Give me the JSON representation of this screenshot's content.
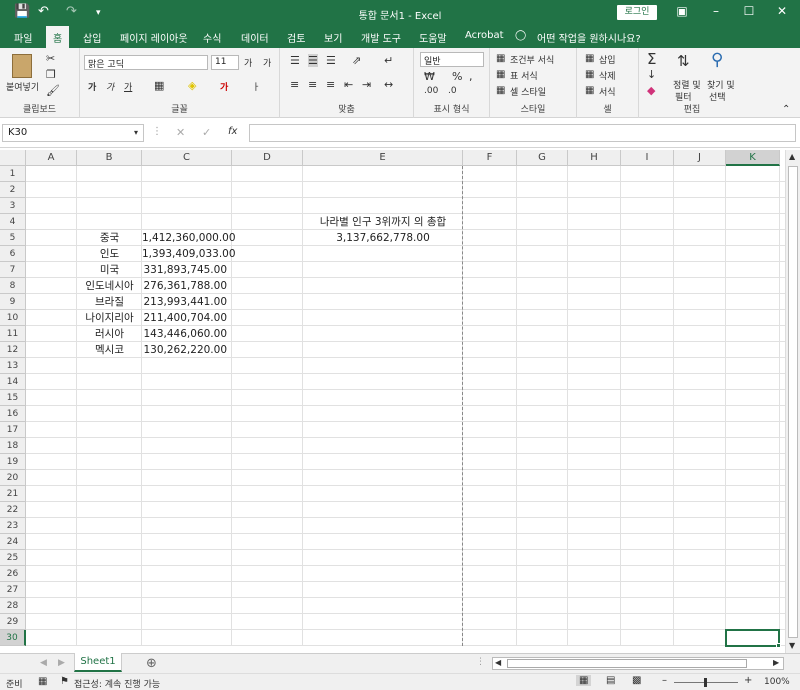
{
  "window": {
    "title": "통합 문서1  -  Excel",
    "login_label": "로그인"
  },
  "tabs": [
    {
      "label": "파일"
    },
    {
      "label": "홈"
    },
    {
      "label": "삽입"
    },
    {
      "label": "페이지 레이아웃"
    },
    {
      "label": "수식"
    },
    {
      "label": "데이터"
    },
    {
      "label": "검토"
    },
    {
      "label": "보기"
    },
    {
      "label": "개발 도구"
    },
    {
      "label": "도움말"
    },
    {
      "label": "Acrobat"
    }
  ],
  "tell_me": "어떤 작업을 원하시나요?",
  "ribbon": {
    "clipboard": {
      "paste": "붙여넣기",
      "label": "클립보드"
    },
    "font": {
      "name": "맑은 고딕",
      "size": "11",
      "label": "글꼴"
    },
    "alignment": {
      "label": "맞춤"
    },
    "number": {
      "format": "일반",
      "label": "표시 형식"
    },
    "styles": {
      "conditional": "조건부 서식",
      "table": "표 서식",
      "cell": "셀 스타일",
      "label": "스타일"
    },
    "cells": {
      "insert": "삽입",
      "delete": "삭제",
      "format": "서식",
      "label": "셀"
    },
    "editing": {
      "sort": "정렬 및",
      "filter": "필터",
      "find": "찾기 및",
      "select": "선택",
      "label": "편집"
    }
  },
  "formula_bar": {
    "name_box": "K30",
    "fx": "fx",
    "value": ""
  },
  "columns": [
    "A",
    "B",
    "C",
    "D",
    "E",
    "F",
    "G",
    "H",
    "I",
    "J",
    "K"
  ],
  "rows": [
    "1",
    "2",
    "3",
    "4",
    "5",
    "6",
    "7",
    "8",
    "9",
    "10",
    "11",
    "12",
    "13",
    "14",
    "15",
    "16",
    "17",
    "18",
    "19",
    "20",
    "21",
    "22",
    "23",
    "24",
    "25",
    "26",
    "27",
    "28",
    "29",
    "30"
  ],
  "cells": {
    "E4": "나라별 인구 3위까지 의 총합",
    "E5": "3,137,662,778.00",
    "B5": "중국",
    "C5": "1,412,360,000.00",
    "B6": "인도",
    "C6": "1,393,409,033.00",
    "B7": "미국",
    "C7": "331,893,745.00",
    "B8": "인도네시아",
    "C8": "276,361,788.00",
    "B9": "브라질",
    "C9": "213,993,441.00",
    "B10": "나이지리아",
    "C10": "211,400,704.00",
    "B11": "러시아",
    "C11": "143,446,060.00",
    "B12": "멕시코",
    "C12": "130,262,220.00"
  },
  "sheet_tab": "Sheet1",
  "status": {
    "ready": "준비",
    "accessibility": "접근성: 계속 진행 가능",
    "zoom": "100%"
  }
}
